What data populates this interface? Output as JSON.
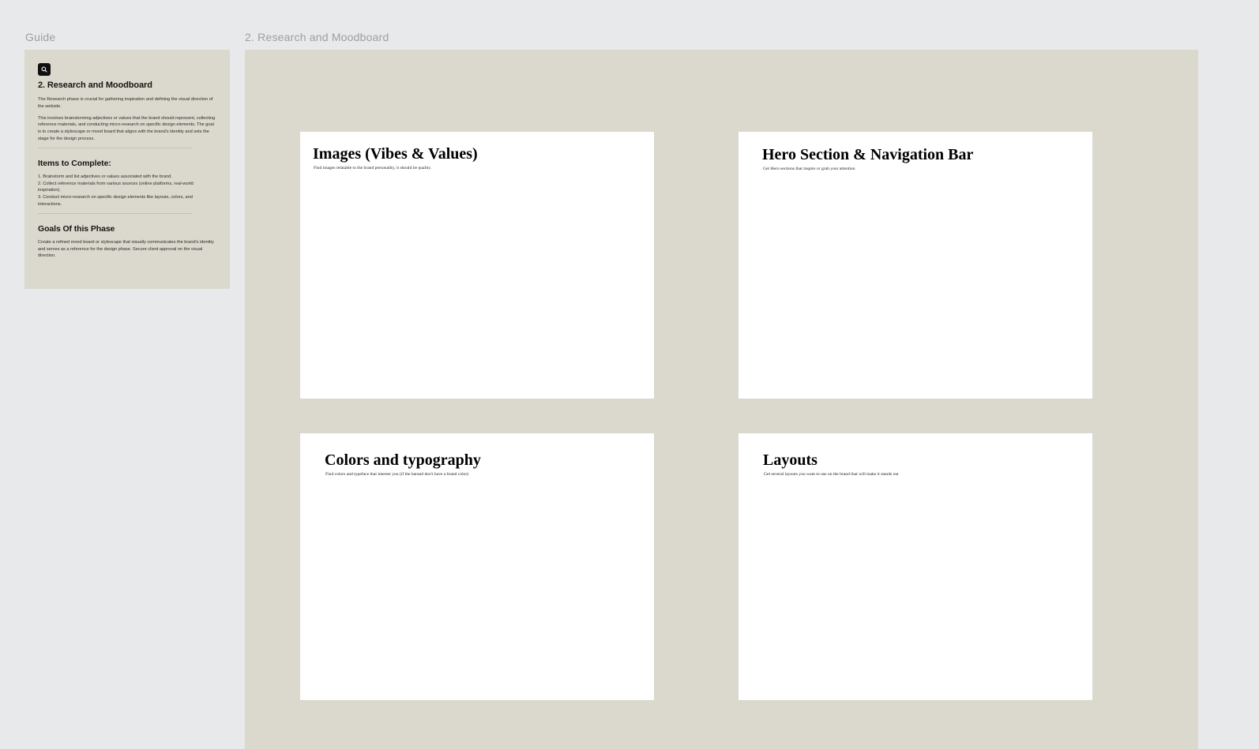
{
  "labels": {
    "guide": "Guide",
    "board": "2. Research and Moodboard"
  },
  "guide": {
    "icon": "search-icon",
    "title": "2. Research and Moodboard",
    "paragraphs": [
      "The Research phase is crucial for gathering inspiration and defining the visual direction of the website.",
      "This involves brainstorming adjectives or values that the brand should represent, collecting reference materials, and conducting micro-research on specific design elements. The goal is to create a stylescape or mood board that aligns with the brand's identity and sets the stage for the design process."
    ],
    "items_heading": "Items to Complete:",
    "items": [
      "1. Brainstorm and list adjectives or values associated with the brand.",
      "2. Collect reference materials from various sources (online platforms, real-world inspiration).",
      "3. Conduct micro-research on specific design elements like layouts, colors, and interactions."
    ],
    "goals_heading": "Goals Of this Phase",
    "goals_text": "Create a refined mood board or stylescape that visually communicates the brand's identity and serves as a reference for the design phase. Secure client approval on the visual direction."
  },
  "panels": [
    {
      "title": "Images (Vibes & Values)",
      "subtitle": "Find images relatable to the brand personality, it should be quality."
    },
    {
      "title": "Hero Section & Navigation Bar",
      "subtitle": "Get Hero sections that inspire or grab your attention"
    },
    {
      "title": "Colors and typography",
      "subtitle": "Find colors and typeface that interest you (if the barand don't have a brand color)"
    },
    {
      "title": "Layouts",
      "subtitle": "Get several layouts you want to use on the brand that will make it stands out"
    }
  ],
  "colors": {
    "canvas": "#e8e9ea",
    "card": "#dbd9cd",
    "panel": "#ffffff",
    "label": "#9ba0a4"
  }
}
